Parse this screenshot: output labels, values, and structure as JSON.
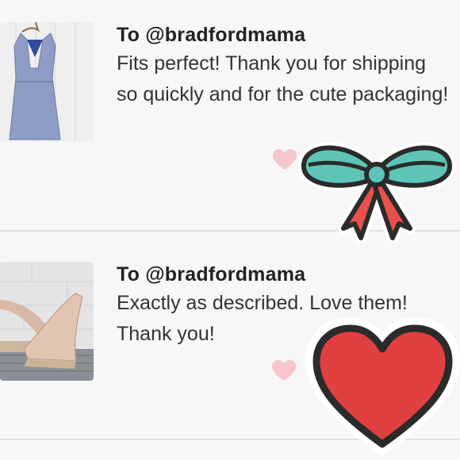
{
  "reviews": [
    {
      "recipient": "To @bradfordmama",
      "message": "Fits perfect! Thank you for shipping so quickly and for the cute packaging!",
      "image": "dress-photo"
    },
    {
      "recipient": "To @bradfordmama",
      "message": "Exactly as described. Love them! Thank you!",
      "image": "shoes-photo"
    }
  ],
  "icons": {
    "like": "heart-icon",
    "stickers": [
      "bow-sticker",
      "heart-sticker"
    ]
  },
  "colors": {
    "background": "#f7f7f7",
    "like_heart": "#f6c6cc",
    "bow_teal": "#5fc4b8",
    "bow_red": "#e8514b",
    "sticker_heart": "#e0403f",
    "outline": "#2b2b2b"
  }
}
